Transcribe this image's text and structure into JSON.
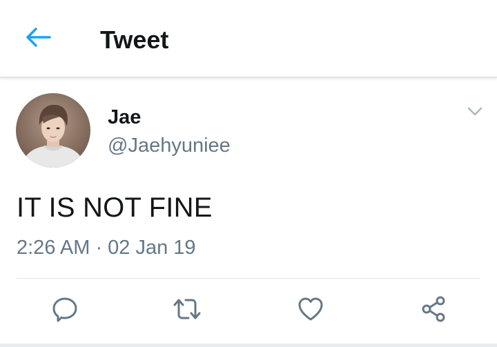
{
  "header": {
    "back_icon": "arrow-left-icon",
    "title": "Tweet"
  },
  "tweet": {
    "author": {
      "display_name": "Jae",
      "handle": "@Jaehyuniee",
      "avatar": "profile-photo"
    },
    "menu_icon": "chevron-down-icon",
    "text": "IT IS NOT FINE",
    "timestamp": "2:26 AM · 02 Jan 19"
  },
  "actions": [
    {
      "name": "reply",
      "icon": "reply-icon"
    },
    {
      "name": "retweet",
      "icon": "retweet-icon"
    },
    {
      "name": "like",
      "icon": "heart-icon"
    },
    {
      "name": "share",
      "icon": "share-icon"
    }
  ],
  "colors": {
    "accent": "#1da1f2",
    "text_primary": "#14171a",
    "text_secondary": "#657786",
    "icon_gray": "#657786",
    "divider": "#e1e8ed"
  }
}
